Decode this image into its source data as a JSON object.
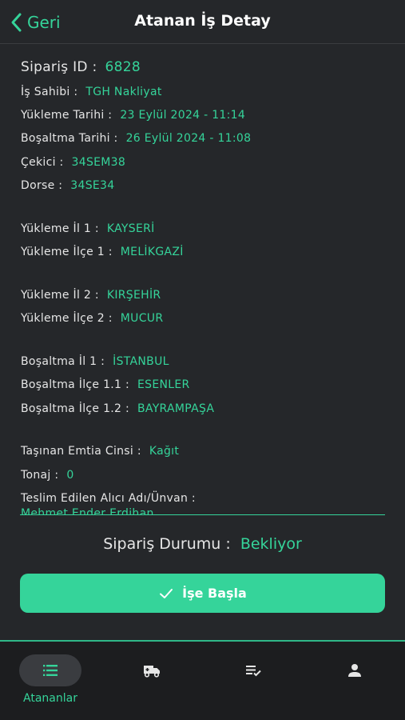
{
  "header": {
    "back_label": "Geri",
    "title": "Atanan İş Detay"
  },
  "order": {
    "id_label": "Sipariş ID :",
    "id_value": "6828",
    "fields": [
      {
        "label": "İş Sahibi :",
        "value": "TGH Nakliyat"
      },
      {
        "label": "Yükleme Tarihi :",
        "value": "23 Eylül 2024 - 11:14"
      },
      {
        "label": "Boşaltma Tarihi :",
        "value": "26 Eylül 2024 - 11:08"
      },
      {
        "label": "Çekici :",
        "value": "34SEM38"
      },
      {
        "label": "Dorse :",
        "value": "34SE34"
      },
      {
        "label": "Yükleme İl 1 :",
        "value": "KAYSERİ"
      },
      {
        "label": "Yükleme İlçe 1 :",
        "value": "MELİKGAZİ"
      },
      {
        "label": "Yükleme İl 2 :",
        "value": "KIRŞEHİR"
      },
      {
        "label": "Yükleme İlçe 2 :",
        "value": "MUCUR"
      },
      {
        "label": "Boşaltma İl 1 :",
        "value": "İSTANBUL"
      },
      {
        "label": "Boşaltma İlçe 1.1 :",
        "value": "ESENLER"
      },
      {
        "label": "Boşaltma İlçe 1.2 :",
        "value": "BAYRAMPAŞA"
      },
      {
        "label": "Taşınan Emtia Cinsi :",
        "value": "Kağıt"
      },
      {
        "label": "Tonaj :",
        "value": "0"
      },
      {
        "label": "Teslim Edilen Alıcı Adı/Ünvan :",
        "value": "Mehmet Ender Erdihan"
      }
    ]
  },
  "status": {
    "label": "Sipariş Durumu :",
    "value": "Bekliyor"
  },
  "action": {
    "start_label": "İşe Başla"
  },
  "tabs": [
    {
      "icon": "list-icon",
      "label": "Atananlar",
      "active": true
    },
    {
      "icon": "truck-icon",
      "label": "",
      "active": false
    },
    {
      "icon": "checklist-icon",
      "label": "",
      "active": false
    },
    {
      "icon": "person-icon",
      "label": "",
      "active": false
    }
  ],
  "colors": {
    "accent": "#35d49a",
    "background": "#25272a",
    "tabbar": "#1c1d1f"
  }
}
